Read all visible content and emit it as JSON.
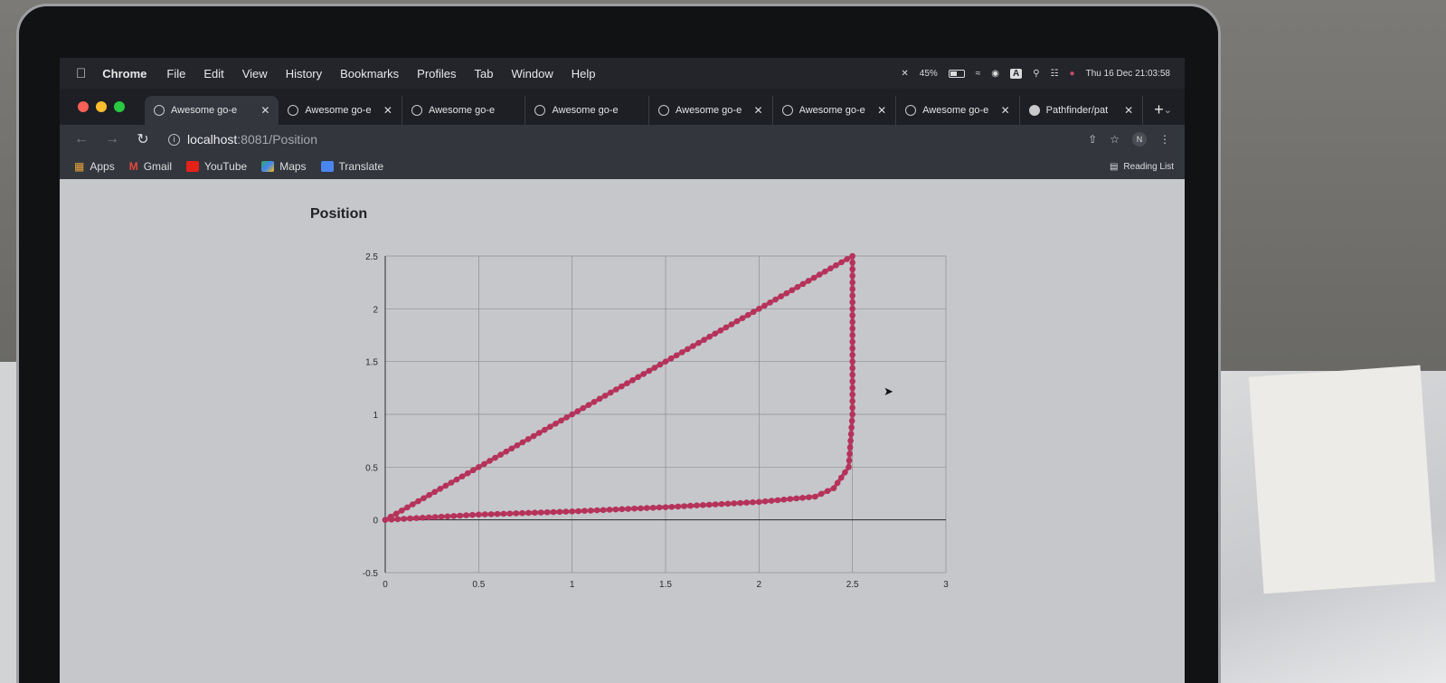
{
  "menubar": {
    "app": "Chrome",
    "items": [
      "File",
      "Edit",
      "View",
      "History",
      "Bookmarks",
      "Profiles",
      "Tab",
      "Window",
      "Help"
    ],
    "battery": "45%",
    "datetime": "Thu 16 Dec  21:03:58",
    "status_letter": "A"
  },
  "tabs": [
    {
      "title": "Awesome go-e",
      "active": true
    },
    {
      "title": "Awesome go-e"
    },
    {
      "title": "Awesome go-e"
    },
    {
      "title": "Awesome go-e"
    },
    {
      "title": "Awesome go-e"
    },
    {
      "title": "Awesome go-e"
    },
    {
      "title": "Awesome go-e"
    },
    {
      "title": "Pathfinder/pat"
    }
  ],
  "address": {
    "host": "localhost",
    "path": ":8081/Position"
  },
  "profile_initial": "N",
  "bookmarks": [
    "Apps",
    "Gmail",
    "YouTube",
    "Maps",
    "Translate"
  ],
  "reading_list": "Reading List",
  "page": {
    "title": "Position"
  },
  "chart_data": {
    "type": "scatter",
    "title": "Position",
    "xlabel": "",
    "ylabel": "",
    "xlim": [
      0,
      3
    ],
    "ylim": [
      -0.5,
      2.5
    ],
    "xticks": [
      "0",
      "0.5",
      "1",
      "1.5",
      "2",
      "2.5",
      "3"
    ],
    "yticks": [
      "-0.5",
      "0",
      "0.5",
      "1",
      "1.5",
      "2",
      "2.5"
    ],
    "grid": true,
    "series": [
      {
        "color": "#b5325a",
        "x": [
          0,
          0.5,
          1.0,
          1.5,
          2.0,
          2.5,
          2.5,
          2.5,
          2.5,
          2.48,
          2.4,
          2.3,
          2.0,
          1.5,
          1.0,
          0.5,
          0
        ],
        "y": [
          0,
          0.5,
          1.0,
          1.5,
          2.0,
          2.5,
          2.0,
          1.5,
          1.0,
          0.5,
          0.3,
          0.22,
          0.17,
          0.12,
          0.08,
          0.05,
          0
        ]
      }
    ]
  },
  "colors": {
    "line": "#b5325a",
    "menubar": "#23252b",
    "page_bg": "#c5c7cb"
  }
}
